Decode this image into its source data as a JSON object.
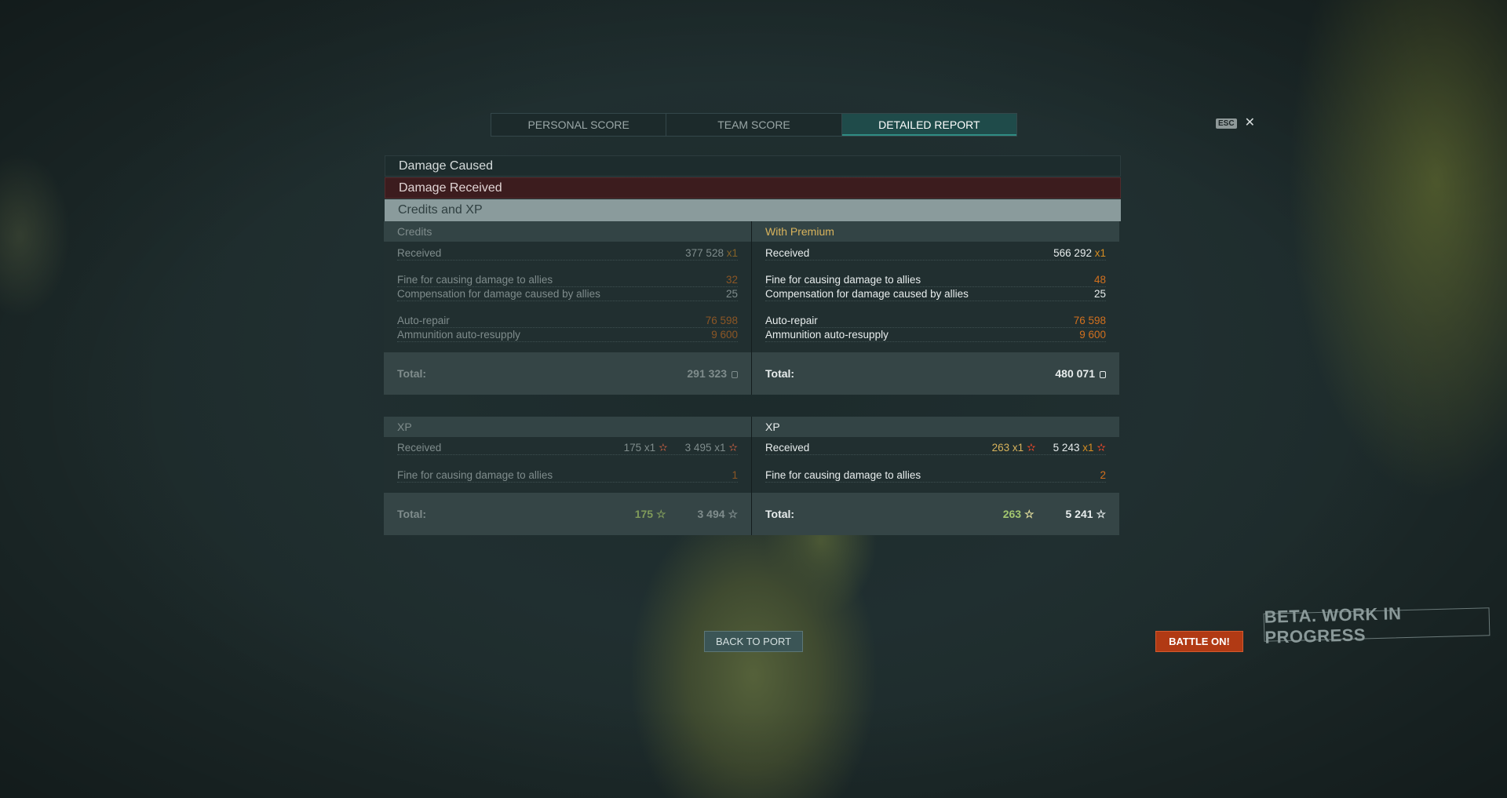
{
  "tabs": [
    "PERSONAL SCORE",
    "TEAM SCORE",
    "DETAILED REPORT"
  ],
  "esc": {
    "badge": "ESC",
    "close": "✕"
  },
  "sections": {
    "damage_caused": "Damage Caused",
    "damage_received": "Damage Received",
    "credits_xp": "Credits and XP"
  },
  "credits": {
    "header": "Credits",
    "received": {
      "label": "Received",
      "value": "377 528",
      "mult": "x1"
    },
    "fine": {
      "label": "Fine for causing damage to allies",
      "value": "32"
    },
    "compensation": {
      "label": "Compensation for damage caused by allies",
      "value": "25"
    },
    "autorepair": {
      "label": "Auto-repair",
      "value": "76 598"
    },
    "ammo": {
      "label": "Ammunition auto-resupply",
      "value": "9 600"
    },
    "total": {
      "label": "Total:",
      "value": "291 323"
    }
  },
  "premium": {
    "header": "With Premium",
    "received": {
      "label": "Received",
      "value": "566 292",
      "mult": "x1"
    },
    "fine": {
      "label": "Fine for causing damage to allies",
      "value": "48"
    },
    "compensation": {
      "label": "Compensation for damage caused by allies",
      "value": "25"
    },
    "autorepair": {
      "label": "Auto-repair",
      "value": "76 598"
    },
    "ammo": {
      "label": "Ammunition auto-resupply",
      "value": "9 600"
    },
    "total": {
      "label": "Total:",
      "value": "480 071"
    }
  },
  "xp": {
    "header": "XP",
    "received": {
      "label": "Received",
      "ship": "175",
      "ship_mult": "x1",
      "free": "3 495",
      "free_mult": "x1"
    },
    "fine": {
      "label": "Fine for causing damage to allies",
      "value": "1"
    },
    "total": {
      "label": "Total:",
      "ship": "175",
      "free": "3 494"
    }
  },
  "xp_premium": {
    "header": "XP",
    "received": {
      "label": "Received",
      "ship": "263",
      "ship_mult": "x1",
      "free": "5 243",
      "free_mult": "x1"
    },
    "fine": {
      "label": "Fine for causing damage to allies",
      "value": "2"
    },
    "total": {
      "label": "Total:",
      "ship": "263",
      "free": "5 241"
    }
  },
  "buttons": {
    "back": "BACK TO PORT",
    "battle": "BATTLE ON!"
  },
  "beta": "BETA. WORK IN PROGRESS",
  "colors": {
    "accent_tab": "#1f4b4a",
    "penalty": "#d2701e",
    "premium": "#d8b35c",
    "battle": "#b13a14"
  }
}
